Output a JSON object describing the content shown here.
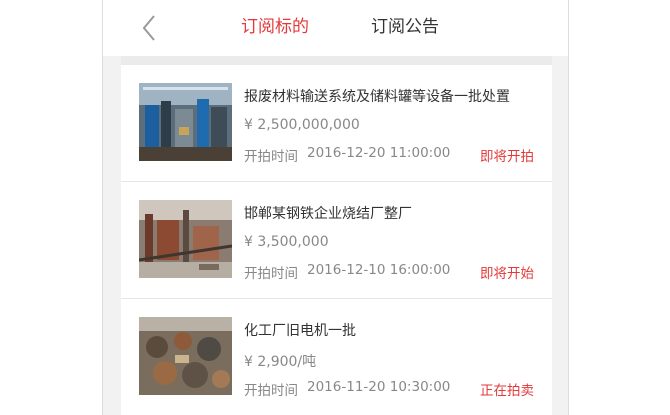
{
  "header": {
    "tabs": [
      {
        "label": "订阅标的",
        "active": true
      },
      {
        "label": "订阅公告",
        "active": false
      }
    ]
  },
  "colors": {
    "accent": "#e23a3a",
    "text": "#333333",
    "muted": "#888888"
  },
  "items": [
    {
      "title": "报废材料输送系统及储料罐等设备一批处置",
      "price": "¥ 2,500,000,000",
      "time_label": "开拍时间",
      "time": "2016-12-20 11:00:00",
      "status": "即将开拍",
      "image": "factory-interior-photo"
    },
    {
      "title": "邯郸某钢铁企业烧结厂整厂",
      "price": "¥ 3,500,000",
      "time_label": "开拍时间",
      "time": "2016-12-10 16:00:00",
      "status": "即将开始",
      "image": "steel-plant-photo"
    },
    {
      "title": "化工厂旧电机一批",
      "price": "¥ 2,900/吨",
      "time_label": "开拍时间",
      "time": "2016-11-20 10:30:00",
      "status": "正在拍卖",
      "image": "old-motors-photo"
    }
  ]
}
